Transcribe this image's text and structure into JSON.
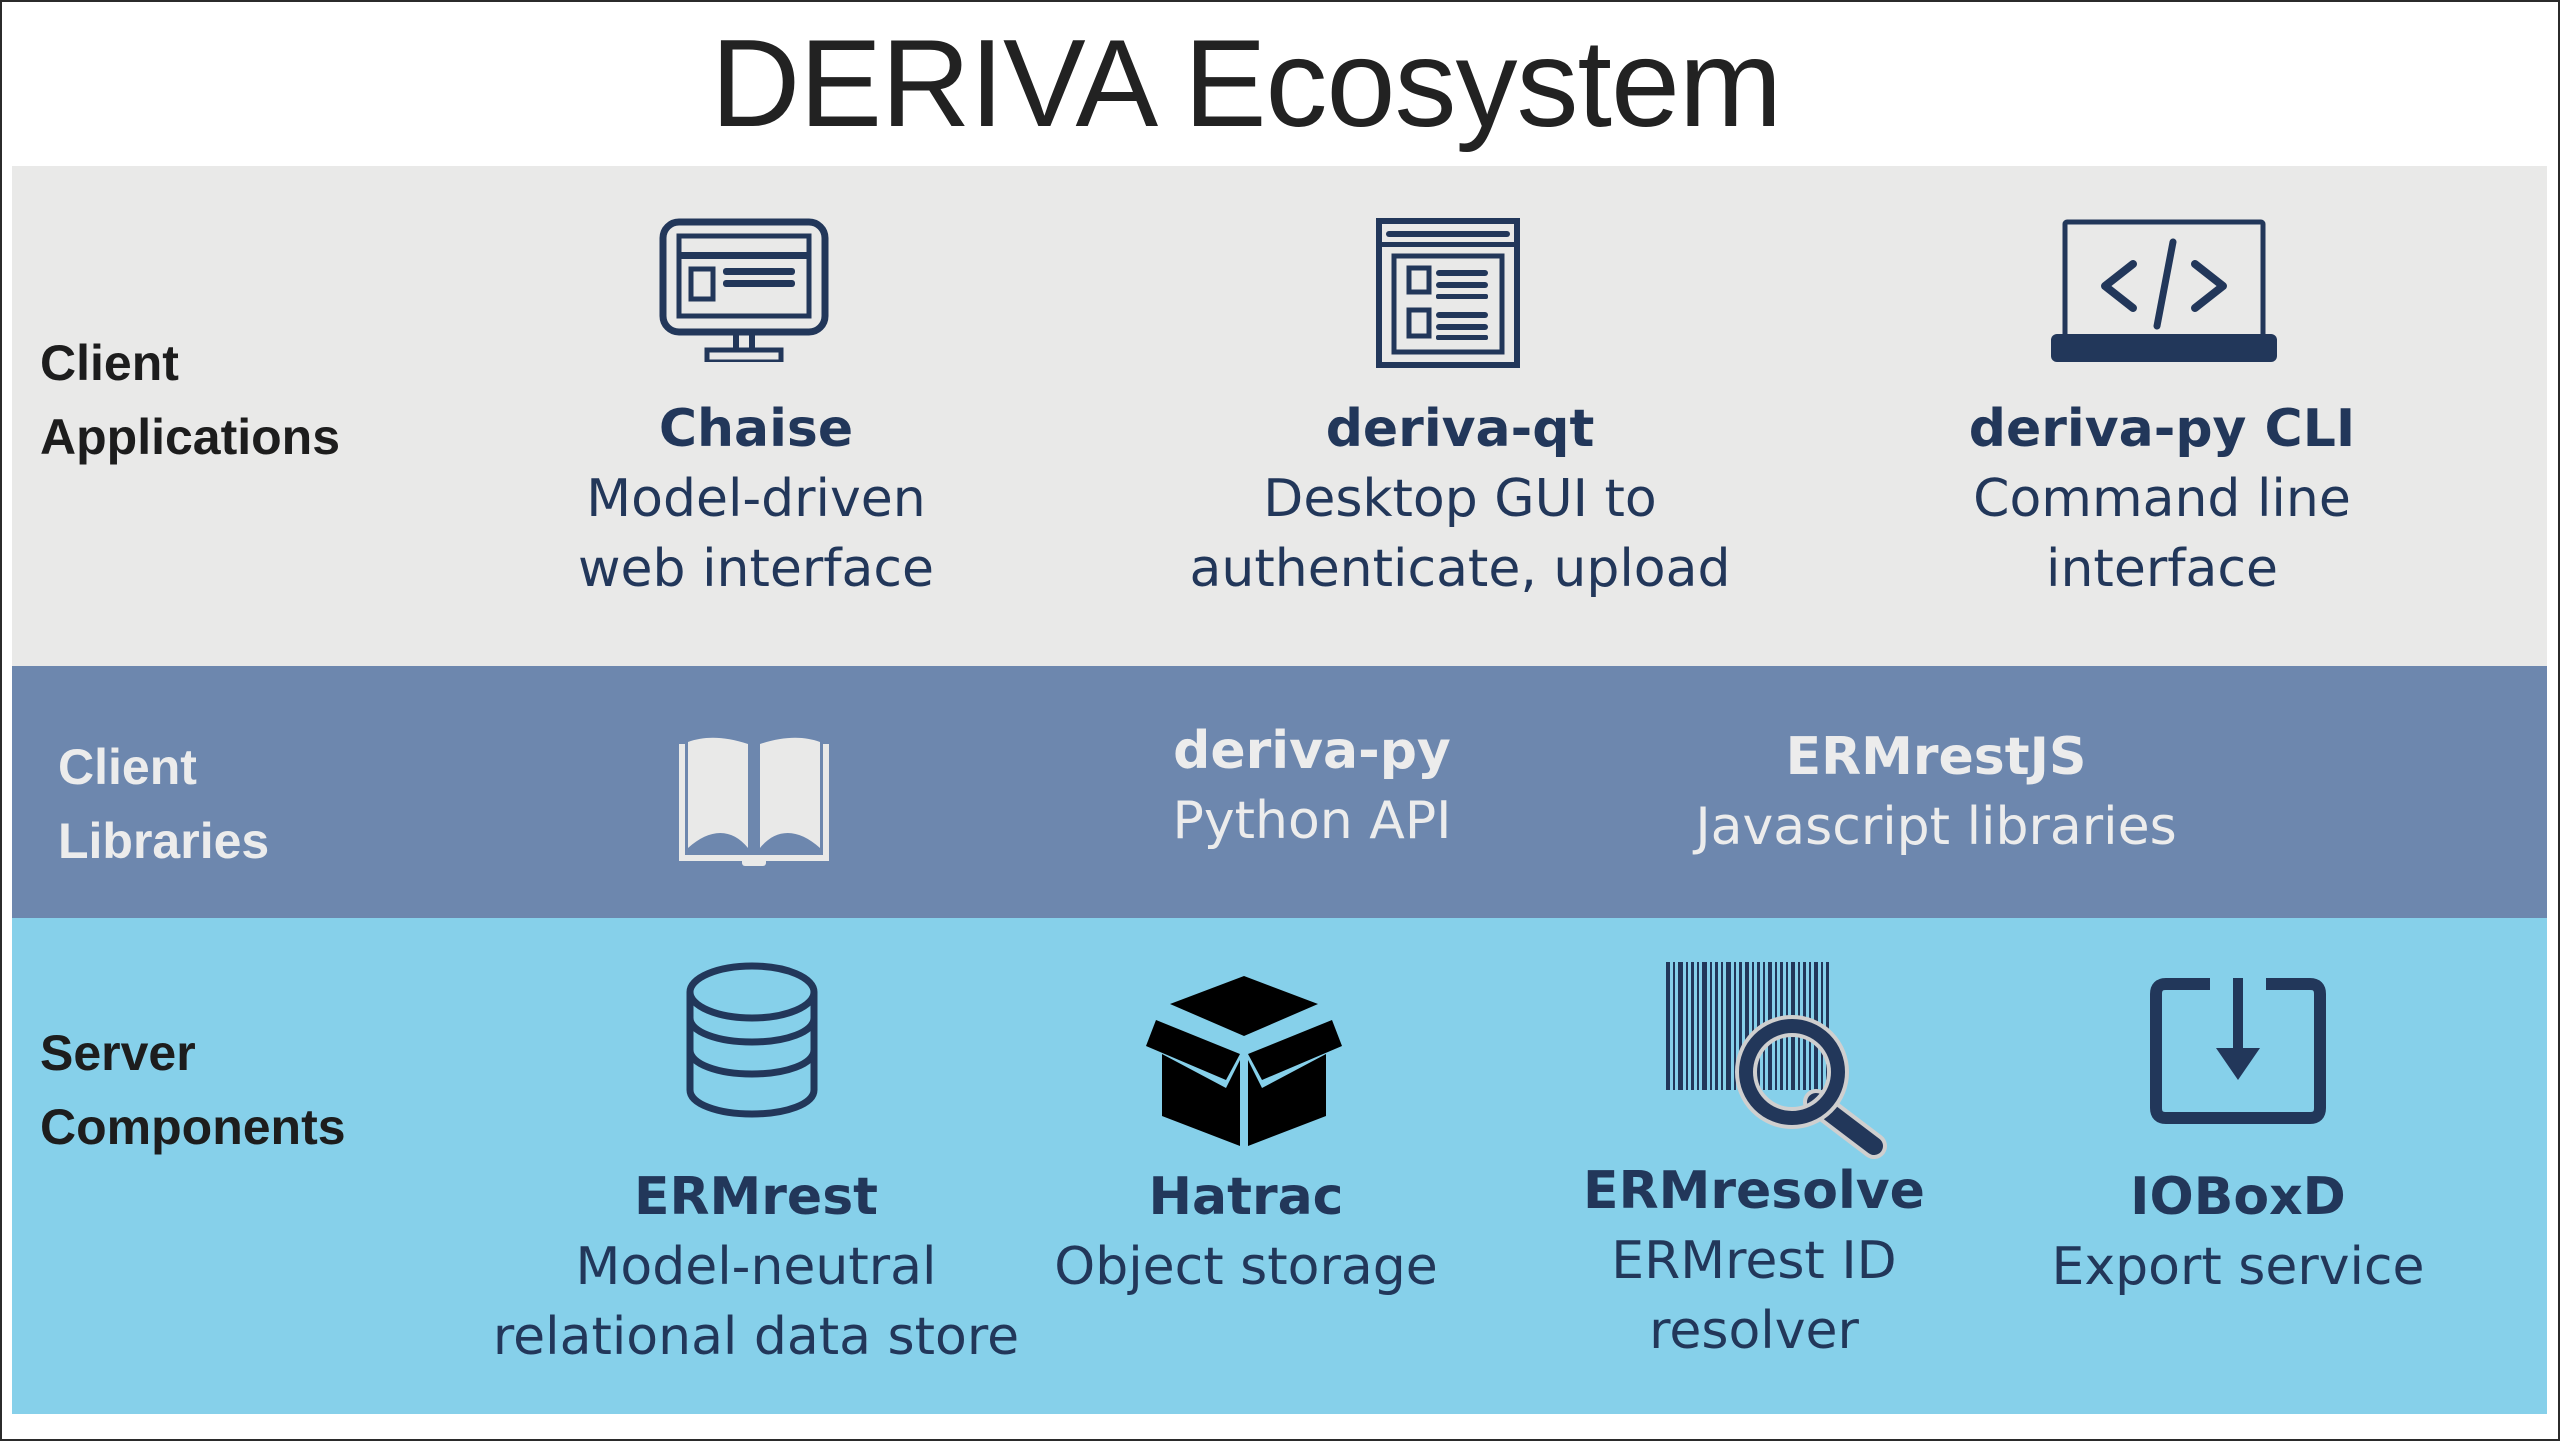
{
  "title": "DERIVA Ecosystem",
  "colors": {
    "apps_band": "#e9e9e8",
    "libs_band": "#6d87ae",
    "server_band": "#86d0ea",
    "navy": "#22375a",
    "light_text": "#ececec"
  },
  "bands": [
    {
      "label_line1": "Client",
      "label_line2": "Applications",
      "items": [
        {
          "icon": "monitor-icon",
          "name": "Chaise",
          "desc_line1": "Model-driven",
          "desc_line2": "web interface"
        },
        {
          "icon": "app-window-icon",
          "name": "deriva-qt",
          "desc_line1": "Desktop GUI to",
          "desc_line2": "authenticate, upload"
        },
        {
          "icon": "laptop-code-icon",
          "name": "deriva-py CLI",
          "desc_line1": "Command line",
          "desc_line2": "interface"
        }
      ]
    },
    {
      "label_line1": "Client",
      "label_line2": "Libraries",
      "icon": "open-book-icon",
      "items": [
        {
          "name": "deriva-py",
          "desc_line1": "Python API"
        },
        {
          "name": "ERMrestJS",
          "desc_line1": "Javascript libraries"
        }
      ]
    },
    {
      "label_line1": "Server",
      "label_line2": "Components",
      "items": [
        {
          "icon": "database-icon",
          "name": "ERMrest",
          "desc_line1": "Model-neutral",
          "desc_line2": "relational data store"
        },
        {
          "icon": "box-icon",
          "name": "Hatrac",
          "desc_line1": "Object storage"
        },
        {
          "icon": "barcode-search-icon",
          "name": "ERMresolve",
          "desc_line1": "ERMrest ID",
          "desc_line2": "resolver"
        },
        {
          "icon": "download-box-icon",
          "name": "IOBoxD",
          "desc_line1": "Export service"
        }
      ]
    }
  ]
}
